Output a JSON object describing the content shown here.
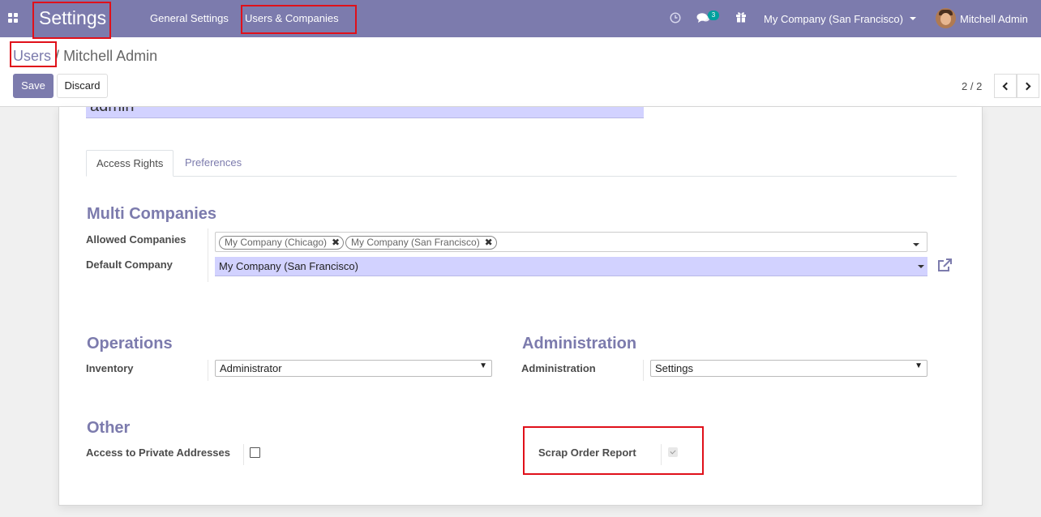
{
  "navbar": {
    "app_title": "Settings",
    "menu": [
      "General Settings",
      "Users & Companies"
    ],
    "messages_count": "3",
    "company_switcher": "My Company (San Francisco)",
    "user_name": "Mitchell Admin"
  },
  "breadcrumb": {
    "parent": "Users",
    "separator": "/",
    "current": "Mitchell Admin"
  },
  "buttons": {
    "save": "Save",
    "discard": "Discard"
  },
  "pager": {
    "value": "2 / 2"
  },
  "form": {
    "login_value": "admin",
    "tabs": [
      "Access Rights",
      "Preferences"
    ],
    "multi_companies": {
      "title": "Multi Companies",
      "allowed_label": "Allowed Companies",
      "allowed_tags": [
        "My Company (Chicago)",
        "My Company (San Francisco)"
      ],
      "default_label": "Default Company",
      "default_value": "My Company (San Francisco)"
    },
    "operations": {
      "title": "Operations",
      "inventory_label": "Inventory",
      "inventory_value": "Administrator"
    },
    "administration": {
      "title": "Administration",
      "admin_label": "Administration",
      "admin_value": "Settings"
    },
    "other": {
      "title": "Other",
      "private_label": "Access to Private Addresses",
      "private_checked": false,
      "scrap_label": "Scrap Order Report",
      "scrap_checked": true
    }
  },
  "colors": {
    "brand": "#7c7bad",
    "badge": "#00a09d",
    "highlight": "#e0101a",
    "required_field": "#d2d2ff"
  }
}
